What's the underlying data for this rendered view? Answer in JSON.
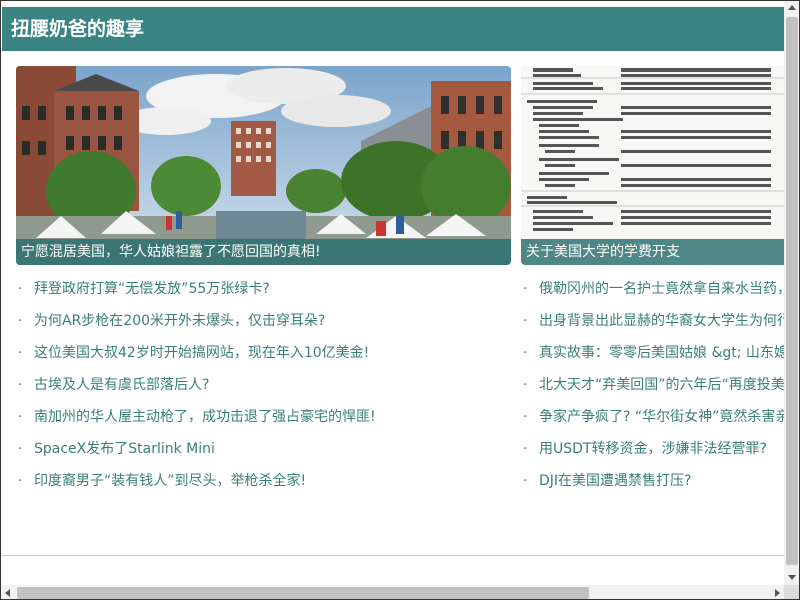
{
  "header": {
    "title": "扭腰奶爸的趣享"
  },
  "featured": [
    {
      "caption": "宁愿混居美国，华人姑娘袒露了不愿回国的真相!",
      "image": "town-square-photo"
    },
    {
      "caption": "关于美国大学的学费开支",
      "image": "tuition-table-image"
    }
  ],
  "left_list": [
    "拜登政府打算“无偿发放”55万张绿卡?",
    "为何AR步枪在200米开外未爆头，仅击穿耳朵?",
    "这位美国大叔42岁时开始搞网站，现在年入10亿美金!",
    "古埃及人是有虞氏部落后人?",
    "南加州的华人屋主动枪了，成功击退了强占豪宅的悍匪!",
    "SpaceX发布了Starlink Mini",
    "印度裔男子“装有钱人”到尽头，举枪杀全家!"
  ],
  "right_list": [
    "俄勒冈州的一名护士竟然拿自来水当药，",
    "出身背景出此显赫的华裔女大学生为何行",
    "真实故事：零零后美国姑娘 &gt; 山东媳",
    "北大天才“弃美回国”的六年后“再度投美",
    "争家产争疯了? “华尔街女神”竟然杀害亲",
    "用USDT转移资金，涉嫌非法经营罪?",
    "DJI在美国遭遇禁售打压?"
  ],
  "bullet": "·",
  "colors": {
    "header_bg": "#3a8583",
    "link_text": "#3a7f7d",
    "caption_bg": "#286e6c"
  }
}
